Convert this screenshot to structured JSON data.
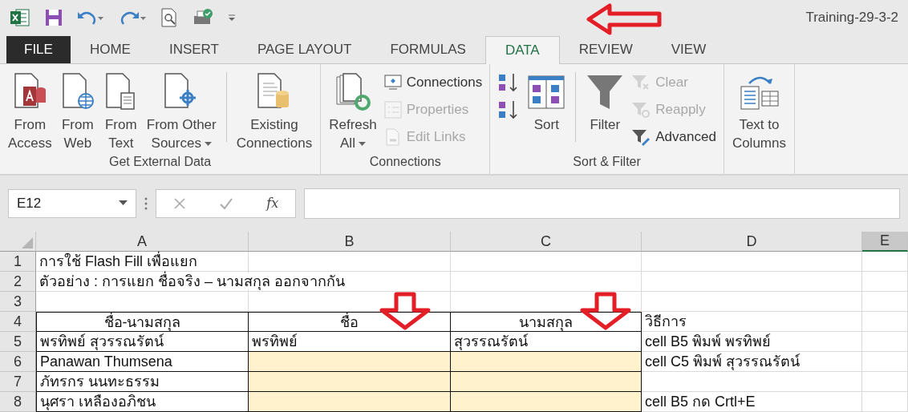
{
  "window": {
    "title": "Training-29-3-2"
  },
  "tabs": [
    {
      "label": "FILE",
      "kind": "file",
      "selected": false
    },
    {
      "label": "HOME",
      "kind": "tab",
      "selected": false
    },
    {
      "label": "INSERT",
      "kind": "tab",
      "selected": false
    },
    {
      "label": "PAGE LAYOUT",
      "kind": "tab",
      "selected": false
    },
    {
      "label": "FORMULAS",
      "kind": "tab",
      "selected": false
    },
    {
      "label": "DATA",
      "kind": "tab",
      "selected": true
    },
    {
      "label": "REVIEW",
      "kind": "tab",
      "selected": false
    },
    {
      "label": "VIEW",
      "kind": "tab",
      "selected": false
    }
  ],
  "ribbon": [
    {
      "label": "Get External Data",
      "columns": [
        {
          "kind": "large",
          "lines": [
            "From",
            "Access"
          ],
          "dropdown": false
        },
        {
          "kind": "large",
          "lines": [
            "From",
            "Web"
          ],
          "dropdown": false
        },
        {
          "kind": "large",
          "lines": [
            "From",
            "Text"
          ],
          "dropdown": false
        },
        {
          "kind": "large",
          "lines": [
            "From Other",
            "Sources"
          ],
          "dropdown": true
        },
        {
          "kind": "separator"
        },
        {
          "kind": "large",
          "lines": [
            "Existing",
            "Connections"
          ],
          "dropdown": false
        }
      ]
    },
    {
      "label": "Connections",
      "columns": [
        {
          "kind": "large",
          "lines": [
            "Refresh",
            "All"
          ],
          "dropdown": true
        },
        {
          "kind": "stack",
          "items": [
            {
              "label": "Connections",
              "disabled": false
            },
            {
              "label": "Properties",
              "disabled": true
            },
            {
              "label": "Edit Links",
              "disabled": true
            }
          ]
        }
      ]
    },
    {
      "label": "Sort & Filter",
      "columns": [
        {
          "kind": "stack",
          "items": [
            {
              "disabled": false
            },
            {
              "disabled": false
            }
          ]
        },
        {
          "kind": "large",
          "lines": [
            "Sort"
          ],
          "dropdown": false
        },
        {
          "kind": "separator"
        },
        {
          "kind": "large",
          "lines": [
            "Filter"
          ],
          "dropdown": false
        },
        {
          "kind": "stack",
          "items": [
            {
              "label": "Clear",
              "disabled": true
            },
            {
              "label": "Reapply",
              "disabled": true
            },
            {
              "label": "Advanced",
              "disabled": false
            }
          ]
        }
      ]
    },
    {
      "columns": [
        {
          "kind": "large",
          "lines": [
            "Text to",
            "Columns"
          ],
          "dropdown": false
        }
      ]
    }
  ],
  "formula_bar": {
    "name_box": "E12",
    "function_label": "fx"
  },
  "sheet": {
    "columns": [
      {
        "label": "A",
        "selected": false
      },
      {
        "label": "B",
        "selected": false
      },
      {
        "label": "C",
        "selected": false
      },
      {
        "label": "D",
        "selected": false
      },
      {
        "label": "E",
        "selected": true
      }
    ],
    "rows": [
      {
        "number": "1",
        "kind": "plain",
        "cells": [
          {
            "text": "การใช้ Flash Fill เพื่อแยก",
            "filled": false
          },
          {
            "filled": false
          },
          {
            "filled": false
          },
          {
            "filled": false
          }
        ]
      },
      {
        "number": "2",
        "kind": "plain",
        "cells": [
          {
            "text": "ตัวอย่าง : การแยก ชื่อจริง  – นามสกุล ออกจากกัน",
            "filled": false
          },
          {
            "filled": false
          },
          {
            "filled": false
          },
          {
            "filled": false
          }
        ]
      },
      {
        "number": "3",
        "kind": "plain",
        "cells": [
          {
            "filled": false
          },
          {
            "filled": false
          },
          {
            "filled": false
          },
          {
            "filled": false
          }
        ]
      },
      {
        "number": "4",
        "kind": "header",
        "cells": [
          {
            "text": "ชื่อ-นามสกุล",
            "filled": false
          },
          {
            "text": "ชื่อ",
            "filled": false
          },
          {
            "text": "นามสกุล",
            "filled": false
          },
          {
            "text": "วิธีการ",
            "filled": false
          }
        ]
      },
      {
        "number": "5",
        "kind": "data",
        "cells": [
          {
            "text": "พรทิพย์ สุวรรณรัตน์",
            "filled": false
          },
          {
            "text": "พรทิพย์",
            "filled": false
          },
          {
            "text": "สุวรรณรัตน์",
            "filled": false
          },
          {
            "text": "cell B5 พิมพ์ พรทิพย์",
            "filled": false
          }
        ]
      },
      {
        "number": "6",
        "kind": "data",
        "cells": [
          {
            "text": "Panawan Thumsena",
            "filled": false
          },
          {
            "filled": true
          },
          {
            "filled": true
          },
          {
            "text": "cell C5 พิมพ์ สุวรรณรัตน์",
            "filled": false
          }
        ]
      },
      {
        "number": "7",
        "kind": "data",
        "cells": [
          {
            "text": "ภัทรกร นนทะธรรม",
            "filled": false
          },
          {
            "filled": true
          },
          {
            "filled": true
          },
          {
            "filled": false
          }
        ]
      },
      {
        "number": "8",
        "kind": "data",
        "cells": [
          {
            "text": "นุศรา เหลืองอภิชน",
            "filled": false
          },
          {
            "filled": true
          },
          {
            "filled": true
          },
          {
            "text": "cell B5 กด Crtl+E",
            "filled": false
          }
        ]
      }
    ]
  }
}
